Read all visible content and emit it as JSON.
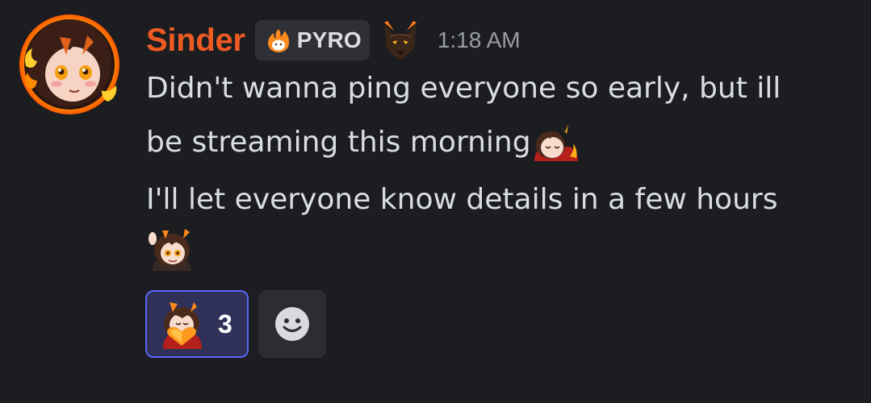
{
  "message": {
    "author": {
      "username": "Sinder",
      "username_color": "#ed5a22",
      "avatar_icon": "fox-girl-avatar-with-flames",
      "role_tag": {
        "label": "PYRO",
        "icon": "flame-icon"
      },
      "role_icon": "wolf-demon-icon"
    },
    "timestamp": "1:18 AM",
    "lines": [
      "Didn't wanna ping everyone so early, but ill",
      "be streaming this morning",
      "I'll let everyone know details in a few hours"
    ],
    "inline_emote": "sleepy-chibi-emote",
    "trailing_emote": "wave-chibi-emote"
  },
  "reactions": [
    {
      "emote": "heart-chibi-emote",
      "count": "3",
      "active": true
    }
  ],
  "add_reaction": {
    "icon": "smiley-face-icon"
  },
  "colors": {
    "background": "#1c1d21",
    "text": "#dbdee1",
    "timestamp": "#9a9ca4",
    "reaction_active_bg": "#2f3159",
    "reaction_active_border": "#5865f2"
  }
}
